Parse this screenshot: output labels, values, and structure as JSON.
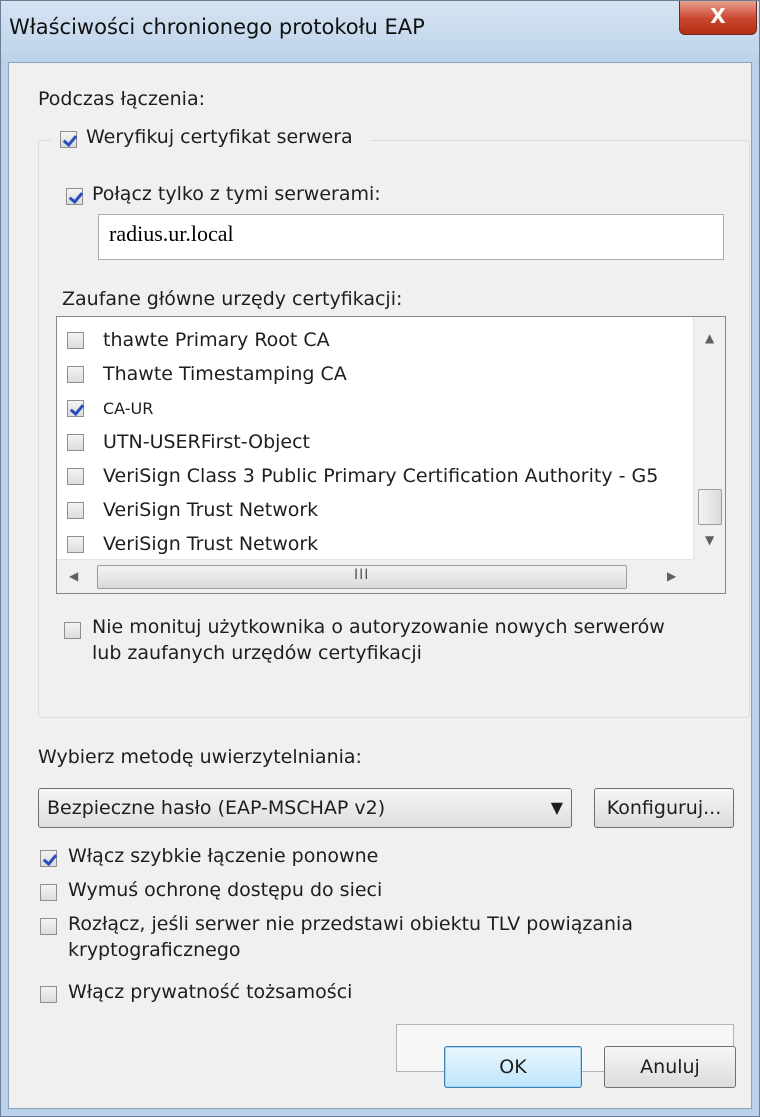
{
  "window": {
    "title": "Właściwości chronionego protokołu EAP",
    "close_label": "X"
  },
  "connect": {
    "heading": "Podczas łączenia:",
    "verify_cert": {
      "label": "Weryfikuj certyfikat serwera",
      "checked": true
    },
    "connect_only": {
      "label": "Połącz tylko z tymi serwerami:",
      "checked": true
    },
    "servers_value": "radius.ur.local",
    "trusted_ca_label": "Zaufane główne urzędy certyfikacji:",
    "ca_list": [
      {
        "name": "thawte Primary Root CA",
        "checked": false
      },
      {
        "name": "Thawte Timestamping CA",
        "checked": false
      },
      {
        "name": "CA-UR",
        "checked": true
      },
      {
        "name": "UTN-USERFirst-Object",
        "checked": false
      },
      {
        "name": "VeriSign Class 3 Public Primary Certification Authority - G5",
        "checked": false
      },
      {
        "name": "VeriSign Trust Network",
        "checked": false
      },
      {
        "name": "VeriSign Trust Network",
        "checked": false
      }
    ],
    "scroll": {
      "up": "▲",
      "down": "▼",
      "left": "◀",
      "right": "▶",
      "grip": "III"
    },
    "no_prompt": {
      "line1": "Nie monituj użytkownika o autoryzowanie nowych serwerów",
      "line2": "lub zaufanych urzędów certyfikacji",
      "checked": false
    }
  },
  "auth": {
    "method_label": "Wybierz metodę uwierzytelniania:",
    "method_value": "Bezpieczne hasło (EAP-MSCHAP v2)",
    "configure_label": "Konfiguruj...",
    "options": [
      {
        "label": "Włącz szybkie łączenie ponowne",
        "checked": true
      },
      {
        "label": "Wymuś ochronę dostępu do sieci",
        "checked": false
      },
      {
        "label": "Rozłącz, jeśli serwer nie przedstawi obiektu TLV powiązania",
        "label2": "kryptograficznego",
        "checked": false
      },
      {
        "label": "Włącz prywatność tożsamości",
        "checked": false
      }
    ]
  },
  "footer": {
    "ok_label": "OK",
    "cancel_label": "Anuluj"
  }
}
